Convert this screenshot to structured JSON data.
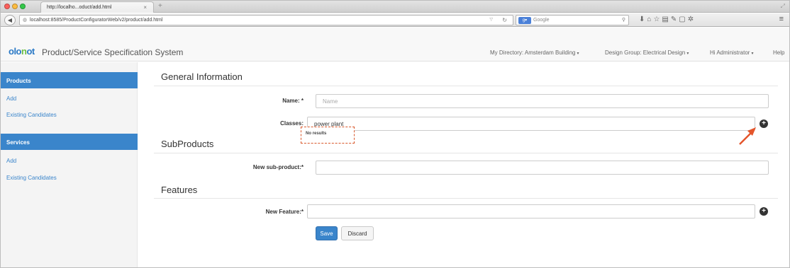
{
  "browser": {
    "tab_title": "http://localho...oduct/add.html",
    "tab_close": "×",
    "new_tab": "+",
    "url": "localhost:8585/ProductConfiguratorWeb/v2/product/add.html",
    "search_engine": "Google",
    "search_placeholder": "Google"
  },
  "header": {
    "logo_text": "olonot",
    "title": "Product/Service Specification System",
    "directory": "My Directory: Amsterdam Building",
    "design_group": "Design Group: Electrical Design",
    "user": "Hi Administrator",
    "help": "Help"
  },
  "sidebar": {
    "products_heading": "Products",
    "products_add": "Add",
    "products_existing": "Existing Candidates",
    "services_heading": "Services",
    "services_add": "Add",
    "services_existing": "Existing Candidates"
  },
  "general": {
    "title": "General Information",
    "name_label": "Name: *",
    "name_placeholder": "Name",
    "classes_label": "Classes:",
    "classes_value": "power plant",
    "no_results": "No results"
  },
  "subproducts": {
    "title": "SubProducts",
    "label": "New sub-product:*"
  },
  "features": {
    "title": "Features",
    "label": "New Feature:*"
  },
  "actions": {
    "save": "Save",
    "discard": "Discard"
  },
  "colors": {
    "primary": "#3a85cb",
    "highlight": "#d9572a"
  }
}
